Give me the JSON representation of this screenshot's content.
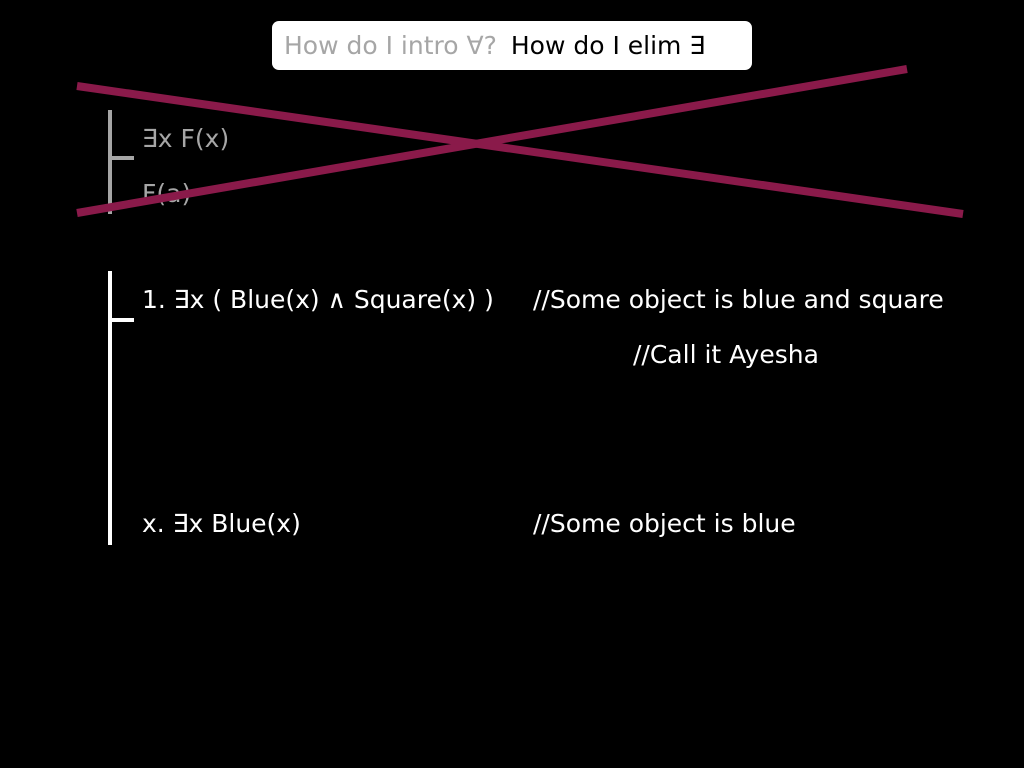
{
  "title": {
    "faded": "How do I intro ∀?",
    "main": "How do I elim ∃"
  },
  "example": {
    "premise": "∃x F(x)",
    "conclusion": "F(a)"
  },
  "proof": {
    "line1": {
      "formula": "1. ∃x ( Blue(x) ∧ Square(x) )",
      "comment": "//Some object is blue and square"
    },
    "name_comment": "//Call it Ayesha",
    "line_x": {
      "formula": "x. ∃x Blue(x)",
      "comment": "//Some object is blue"
    }
  },
  "colors": {
    "background": "#000000",
    "cross_strike": "#8a1a4a",
    "faded_text": "#a6a6a6"
  }
}
